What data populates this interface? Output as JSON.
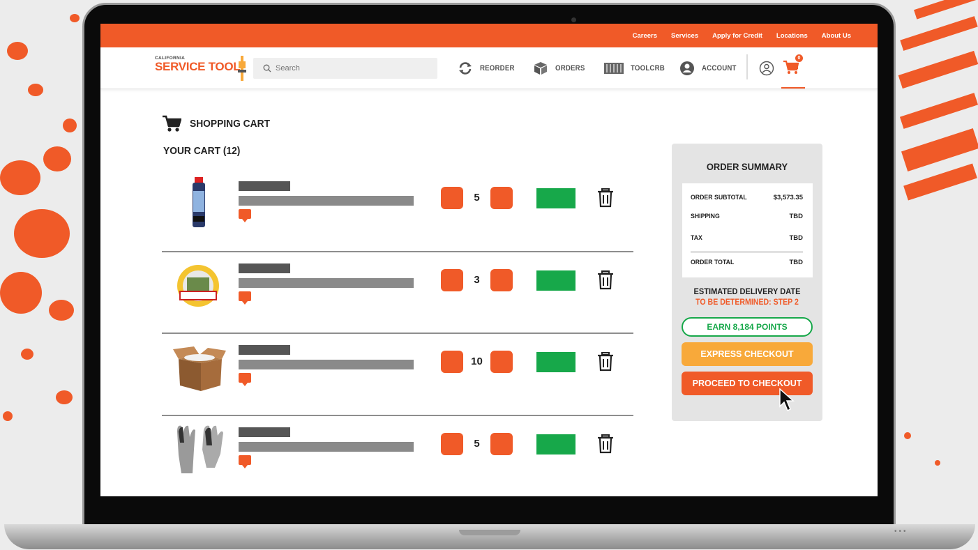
{
  "colors": {
    "brand_orange": "#f05a28",
    "action_green": "#17a84a",
    "express_yellow": "#f8a93a"
  },
  "top_links": [
    "Careers",
    "Services",
    "Apply for Credit",
    "Locations",
    "About Us"
  ],
  "logo": {
    "small": "CALIFORNIA",
    "main": "SERVICE TOOL"
  },
  "search": {
    "placeholder": "Search",
    "icon": "search-icon"
  },
  "nav": {
    "reorder": {
      "label": "REORDER",
      "icon": "reorder-icon"
    },
    "orders": {
      "label": "ORDERS",
      "icon": "box-icon"
    },
    "toolcrib": {
      "label": "TOOLCRB",
      "icon": "toolcrib-icon"
    },
    "account": {
      "label": "ACCOUNT",
      "icon": "account-icon"
    }
  },
  "cart_badge": "0",
  "page": {
    "title": "SHOPPING CART",
    "cart_count": "YOUR CART (12)"
  },
  "items": [
    {
      "qty": "5",
      "thumb": "spray-can"
    },
    {
      "qty": "3",
      "thumb": "extension-cord"
    },
    {
      "qty": "10",
      "thumb": "cardboard-box"
    },
    {
      "qty": "5",
      "thumb": "work-gloves"
    }
  ],
  "summary": {
    "title": "ORDER SUMMARY",
    "subtotal_label": "ORDER SUBTOTAL",
    "subtotal_value": "$3,573.35",
    "shipping_label": "SHIPPING",
    "shipping_value": "TBD",
    "tax_label": "TAX",
    "tax_value": "TBD",
    "total_label": "ORDER TOTAL",
    "total_value": "TBD",
    "delivery_label": "ESTIMATED DELIVERY DATE",
    "delivery_value": "TO BE DETERMINED: STEP 2",
    "points": "EARN 8,184 POINTS",
    "express": "EXPRESS CHECKOUT",
    "proceed": "PROCEED TO CHECKOUT"
  }
}
